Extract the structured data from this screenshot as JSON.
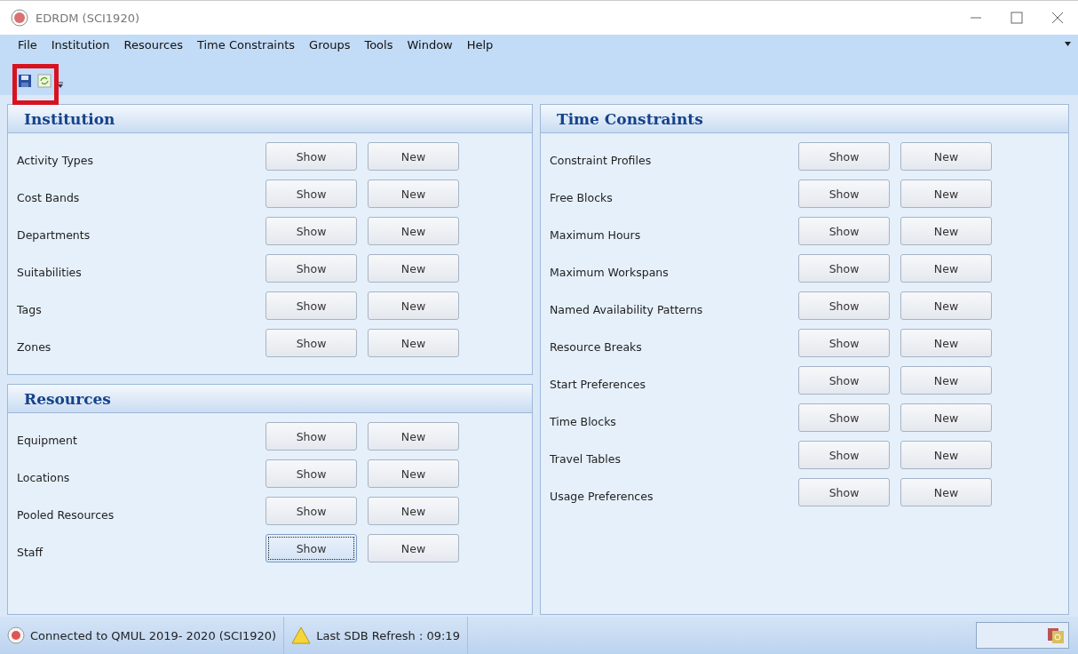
{
  "window": {
    "title": "EDRDM (SCI1920)"
  },
  "menu": [
    "File",
    "Institution",
    "Resources",
    "Time Constraints",
    "Groups",
    "Tools",
    "Window",
    "Help"
  ],
  "toolbar": {
    "highlighted": true
  },
  "left_column": {
    "panels": [
      {
        "title": "Institution",
        "rows": [
          {
            "label": "Activity Types",
            "show": "Show",
            "new": "New",
            "focused": false
          },
          {
            "label": "Cost Bands",
            "show": "Show",
            "new": "New",
            "focused": false
          },
          {
            "label": "Departments",
            "show": "Show",
            "new": "New",
            "focused": false
          },
          {
            "label": "Suitabilities",
            "show": "Show",
            "new": "New",
            "focused": false
          },
          {
            "label": "Tags",
            "show": "Show",
            "new": "New",
            "focused": false
          },
          {
            "label": "Zones",
            "show": "Show",
            "new": "New",
            "focused": false
          }
        ]
      },
      {
        "title": "Resources",
        "rows": [
          {
            "label": "Equipment",
            "show": "Show",
            "new": "New",
            "focused": false
          },
          {
            "label": "Locations",
            "show": "Show",
            "new": "New",
            "focused": false
          },
          {
            "label": "Pooled Resources",
            "show": "Show",
            "new": "New",
            "focused": false
          },
          {
            "label": "Staff",
            "show": "Show",
            "new": "New",
            "focused": true
          }
        ]
      }
    ]
  },
  "right_column": {
    "panels": [
      {
        "title": "Time Constraints",
        "rows": [
          {
            "label": "Constraint Profiles",
            "show": "Show",
            "new": "New",
            "focused": false
          },
          {
            "label": "Free Blocks",
            "show": "Show",
            "new": "New",
            "focused": false
          },
          {
            "label": "Maximum Hours",
            "show": "Show",
            "new": "New",
            "focused": false
          },
          {
            "label": "Maximum Workspans",
            "show": "Show",
            "new": "New",
            "focused": false
          },
          {
            "label": "Named Availability Patterns",
            "show": "Show",
            "new": "New",
            "focused": false
          },
          {
            "label": "Resource Breaks",
            "show": "Show",
            "new": "New",
            "focused": false
          },
          {
            "label": "Start Preferences",
            "show": "Show",
            "new": "New",
            "focused": false
          },
          {
            "label": "Time Blocks",
            "show": "Show",
            "new": "New",
            "focused": false
          },
          {
            "label": "Travel Tables",
            "show": "Show",
            "new": "New",
            "focused": false
          },
          {
            "label": "Usage Preferences",
            "show": "Show",
            "new": "New",
            "focused": false
          }
        ]
      }
    ]
  },
  "status_bar": {
    "connection": "Connected to QMUL 2019- 2020 (SCI1920)",
    "refresh": "Last SDB Refresh : 09:19"
  }
}
